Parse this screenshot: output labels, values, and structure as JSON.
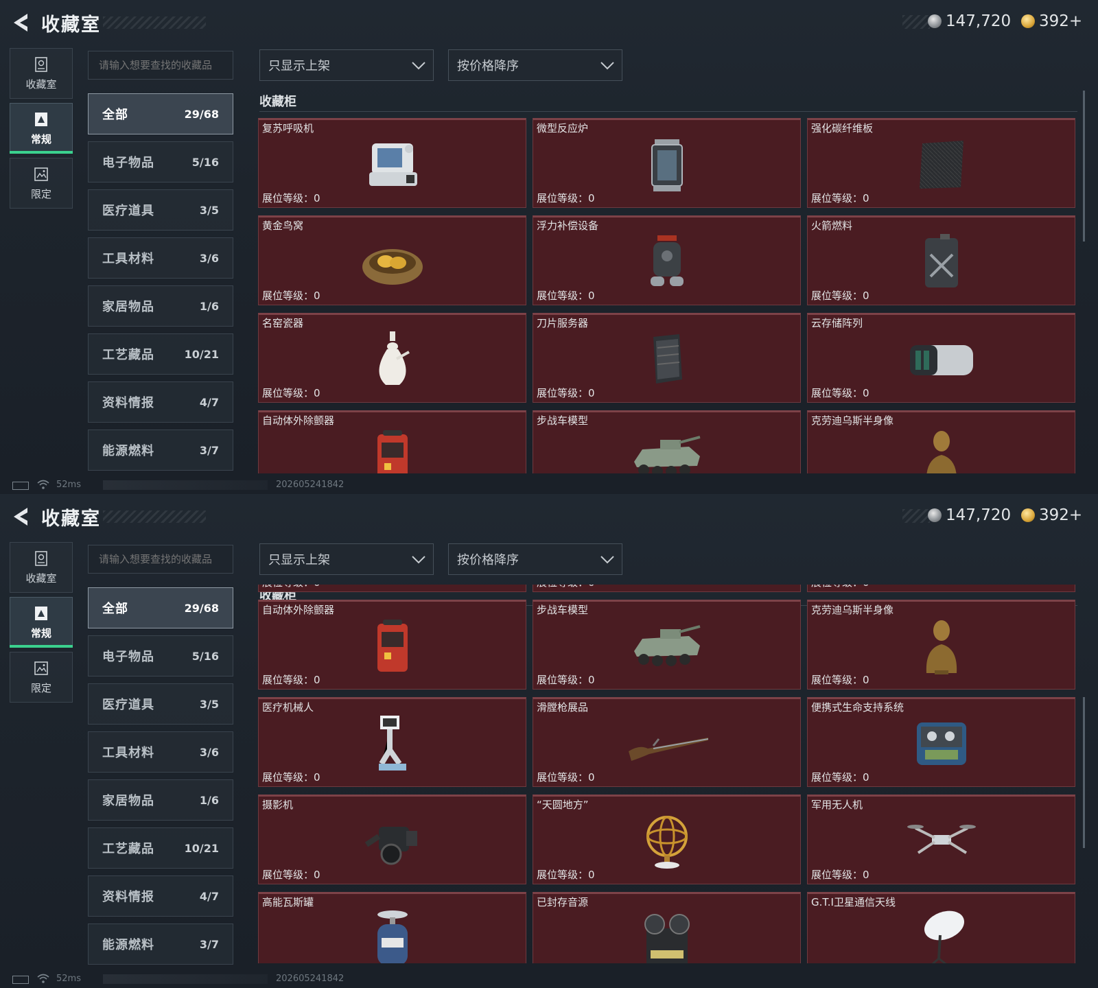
{
  "header": {
    "title": "收藏室"
  },
  "currency": {
    "silver": "147,720",
    "gold": "392+"
  },
  "nav": [
    {
      "label": "收藏室",
      "icon": "trophy-icon"
    },
    {
      "label": "常规",
      "icon": "frame-icon",
      "active": true
    },
    {
      "label": "限定",
      "icon": "image-icon"
    }
  ],
  "search": {
    "placeholder": "请输入想要查找的收藏品"
  },
  "filters": {
    "show": "只显示上架",
    "sort": "按价格降序"
  },
  "categories": [
    {
      "name": "全部",
      "count": "29/68",
      "active": true
    },
    {
      "name": "电子物品",
      "count": "5/16"
    },
    {
      "name": "医疗道具",
      "count": "3/5"
    },
    {
      "name": "工具材料",
      "count": "3/6"
    },
    {
      "name": "家居物品",
      "count": "1/6"
    },
    {
      "name": "工艺藏品",
      "count": "10/21"
    },
    {
      "name": "资料情报",
      "count": "4/7"
    },
    {
      "name": "能源燃料",
      "count": "3/7"
    }
  ],
  "section_title": "收藏柜",
  "level_label": "展位等级：0",
  "items": [
    {
      "name": "复苏呼吸机",
      "icon": "ventilator-icon"
    },
    {
      "name": "微型反应炉",
      "icon": "reactor-icon"
    },
    {
      "name": "强化碳纤维板",
      "icon": "carbon-plate-icon"
    },
    {
      "name": "黄金鸟窝",
      "icon": "golden-nest-icon"
    },
    {
      "name": "浮力补偿设备",
      "icon": "buoyancy-device-icon"
    },
    {
      "name": "火箭燃料",
      "icon": "fuel-can-icon"
    },
    {
      "name": "名窑瓷器",
      "icon": "porcelain-vase-icon"
    },
    {
      "name": "刀片服务器",
      "icon": "server-icon"
    },
    {
      "name": "云存储阵列",
      "icon": "storage-array-icon"
    },
    {
      "name": "自动体外除颤器",
      "icon": "defibrillator-icon"
    },
    {
      "name": "步战车模型",
      "icon": "ifv-model-icon"
    },
    {
      "name": "克劳迪乌斯半身像",
      "icon": "bust-icon"
    },
    {
      "name": "医疗机械人",
      "icon": "medical-robot-icon"
    },
    {
      "name": "滑膛枪展品",
      "icon": "musket-icon"
    },
    {
      "name": "便携式生命支持系统",
      "icon": "life-support-icon"
    },
    {
      "name": "摄影机",
      "icon": "camera-icon"
    },
    {
      "name": "“天圆地方”",
      "icon": "armillary-sphere-icon"
    },
    {
      "name": "军用无人机",
      "icon": "drone-icon"
    },
    {
      "name": "高能瓦斯罐",
      "icon": "gas-canister-icon"
    },
    {
      "name": "已封存音源",
      "icon": "reel-recorder-icon"
    },
    {
      "name": "G.T.I卫星通信天线",
      "icon": "satellite-dish-icon"
    }
  ],
  "status": {
    "ping": "52ms",
    "build": "202605241842"
  },
  "colors": {
    "card_bg": "#4a1c22",
    "accent_green": "#3bd18e",
    "bg": "#1d242c"
  }
}
